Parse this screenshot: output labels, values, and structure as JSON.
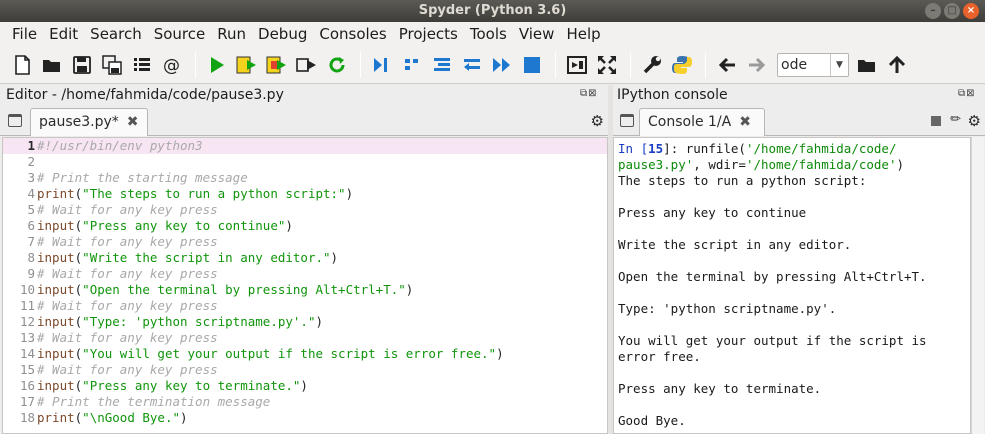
{
  "window": {
    "title": "Spyder (Python 3.6)"
  },
  "menu": [
    "File",
    "Edit",
    "Search",
    "Source",
    "Run",
    "Debug",
    "Consoles",
    "Projects",
    "Tools",
    "View",
    "Help"
  ],
  "toolbar": {
    "workdir_combo": "ode"
  },
  "editor": {
    "pane_title": "Editor - /home/fahmida/code/pause3.py",
    "tab_label": "pause3.py*",
    "lines": [
      {
        "num": "1",
        "parts": [
          {
            "t": "#!/usr/bin/env python3",
            "c": "comment"
          }
        ]
      },
      {
        "num": "2",
        "parts": []
      },
      {
        "num": "3",
        "parts": [
          {
            "t": "# Print the starting message",
            "c": "comment"
          }
        ]
      },
      {
        "num": "4",
        "parts": [
          {
            "t": "print",
            "c": "kw"
          },
          {
            "t": "(",
            "c": "punc"
          },
          {
            "t": "\"The steps to run a python script:\"",
            "c": "str"
          },
          {
            "t": ")",
            "c": "punc"
          }
        ]
      },
      {
        "num": "5",
        "parts": [
          {
            "t": "# Wait for any key press",
            "c": "comment"
          }
        ]
      },
      {
        "num": "6",
        "parts": [
          {
            "t": "input",
            "c": "kw"
          },
          {
            "t": "(",
            "c": "punc"
          },
          {
            "t": "\"Press any key to continue\"",
            "c": "str"
          },
          {
            "t": ")",
            "c": "punc"
          }
        ]
      },
      {
        "num": "7",
        "parts": [
          {
            "t": "# Wait for any key press",
            "c": "comment"
          }
        ]
      },
      {
        "num": "8",
        "parts": [
          {
            "t": "input",
            "c": "kw"
          },
          {
            "t": "(",
            "c": "punc"
          },
          {
            "t": "\"Write the script in any editor.\"",
            "c": "str"
          },
          {
            "t": ")",
            "c": "punc"
          }
        ]
      },
      {
        "num": "9",
        "parts": [
          {
            "t": "# Wait for any key press",
            "c": "comment"
          }
        ]
      },
      {
        "num": "10",
        "parts": [
          {
            "t": "input",
            "c": "kw"
          },
          {
            "t": "(",
            "c": "punc"
          },
          {
            "t": "\"Open the terminal by pressing Alt+Ctrl+T.\"",
            "c": "str"
          },
          {
            "t": ")",
            "c": "punc"
          }
        ]
      },
      {
        "num": "11",
        "parts": [
          {
            "t": "# Wait for any key press",
            "c": "comment"
          }
        ]
      },
      {
        "num": "12",
        "parts": [
          {
            "t": "input",
            "c": "kw"
          },
          {
            "t": "(",
            "c": "punc"
          },
          {
            "t": "\"Type: 'python scriptname.py'.\"",
            "c": "str"
          },
          {
            "t": ")",
            "c": "punc"
          }
        ]
      },
      {
        "num": "13",
        "parts": [
          {
            "t": "# Wait for any key press",
            "c": "comment"
          }
        ]
      },
      {
        "num": "14",
        "parts": [
          {
            "t": "input",
            "c": "kw"
          },
          {
            "t": "(",
            "c": "punc"
          },
          {
            "t": "\"You will get your output if the script is error free.\"",
            "c": "str"
          },
          {
            "t": ")",
            "c": "punc"
          }
        ]
      },
      {
        "num": "15",
        "parts": [
          {
            "t": "# Wait for any key press",
            "c": "comment"
          }
        ]
      },
      {
        "num": "16",
        "parts": [
          {
            "t": "input",
            "c": "kw"
          },
          {
            "t": "(",
            "c": "punc"
          },
          {
            "t": "\"Press any key to terminate.\"",
            "c": "str"
          },
          {
            "t": ")",
            "c": "punc"
          }
        ]
      },
      {
        "num": "17",
        "parts": [
          {
            "t": "# Print the termination message",
            "c": "comment"
          }
        ]
      },
      {
        "num": "18",
        "parts": [
          {
            "t": "print",
            "c": "kw"
          },
          {
            "t": "(",
            "c": "punc"
          },
          {
            "t": "\"\\nGood Bye.\"",
            "c": "str"
          },
          {
            "t": ")",
            "c": "punc"
          }
        ]
      }
    ]
  },
  "console": {
    "pane_title": "IPython console",
    "tab_label": "Console 1/A",
    "lines": [
      [
        {
          "t": "In [",
          "c": "prompt"
        },
        {
          "t": "15",
          "c": "num"
        },
        {
          "t": "]: runfile(",
          "c": "plain"
        },
        {
          "t": "'/home/fahmida/code/",
          "c": "pth"
        }
      ],
      [
        {
          "t": "pause3.py'",
          "c": "pth"
        },
        {
          "t": ", wdir=",
          "c": "plain"
        },
        {
          "t": "'/home/fahmida/code'",
          "c": "pth"
        },
        {
          "t": ")",
          "c": "plain"
        }
      ],
      [
        {
          "t": "The steps to run a python script:",
          "c": "plain"
        }
      ],
      [],
      [
        {
          "t": "Press any key to continue",
          "c": "plain"
        }
      ],
      [],
      [
        {
          "t": "Write the script in any editor.",
          "c": "plain"
        }
      ],
      [],
      [
        {
          "t": "Open the terminal by pressing Alt+Ctrl+T.",
          "c": "plain"
        }
      ],
      [],
      [
        {
          "t": "Type: 'python scriptname.py'.",
          "c": "plain"
        }
      ],
      [],
      [
        {
          "t": "You will get your output if the script is",
          "c": "plain"
        }
      ],
      [
        {
          "t": "error free.",
          "c": "plain"
        }
      ],
      [],
      [
        {
          "t": "Press any key to terminate.",
          "c": "plain"
        }
      ],
      [],
      [
        {
          "t": "Good Bye.",
          "c": "plain"
        }
      ]
    ]
  }
}
